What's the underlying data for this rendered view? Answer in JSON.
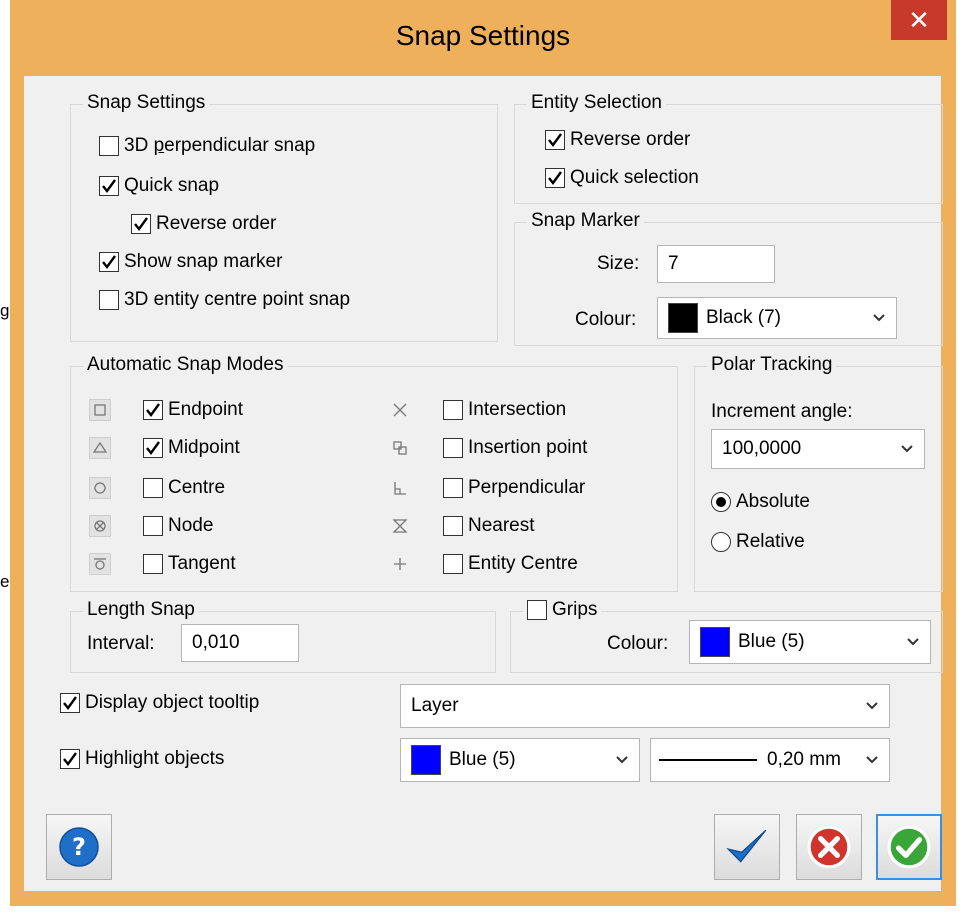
{
  "window": {
    "title": "Snap Settings",
    "close_glyph": "✕"
  },
  "background_fragments": {
    "frag1": "g",
    "frag2": "e"
  },
  "snap_settings": {
    "title": "Snap Settings",
    "perp_snap": {
      "pre": "3D ",
      "underlined": "p",
      "post": "erpendicular snap",
      "checked": false
    },
    "quick_snap": {
      "label": "Quick snap",
      "checked": true
    },
    "reverse_order": {
      "label": "Reverse order",
      "checked": true
    },
    "show_marker": {
      "label": "Show snap marker",
      "checked": true
    },
    "centre_point": {
      "label": "3D entity centre point snap",
      "checked": false
    }
  },
  "entity_selection": {
    "title": "Entity Selection",
    "reverse_order": {
      "label": "Reverse order",
      "checked": true
    },
    "quick_selection": {
      "label": "Quick selection",
      "checked": true
    }
  },
  "snap_marker": {
    "title": "Snap Marker",
    "size_label": "Size:",
    "size_value": "7",
    "colour_label": "Colour:",
    "colour_value": "Black (7)",
    "colour_swatch": "#000000"
  },
  "auto_snap": {
    "title": "Automatic Snap Modes",
    "left": [
      {
        "icon": "square-snap-icon",
        "label": "Endpoint",
        "checked": true
      },
      {
        "icon": "triangle-snap-icon",
        "label": "Midpoint",
        "checked": true
      },
      {
        "icon": "circle-snap-icon",
        "label": "Centre",
        "checked": false
      },
      {
        "icon": "node-snap-icon",
        "label": "Node",
        "checked": false
      },
      {
        "icon": "tangent-snap-icon",
        "label": "Tangent",
        "checked": false
      }
    ],
    "right": [
      {
        "icon": "intersection-snap-icon",
        "label": "Intersection",
        "checked": false
      },
      {
        "icon": "insertion-snap-icon",
        "label": "Insertion point",
        "checked": false
      },
      {
        "icon": "perpendicular-snap-icon",
        "label": "Perpendicular",
        "checked": false
      },
      {
        "icon": "nearest-snap-icon",
        "label": "Nearest",
        "checked": false
      },
      {
        "icon": "entity-centre-snap-icon",
        "label": "Entity Centre",
        "checked": false
      }
    ]
  },
  "polar_tracking": {
    "title": "Polar Tracking",
    "increment_label": "Increment angle:",
    "increment_value": "100,0000",
    "absolute": {
      "label": "Absolute",
      "selected": true
    },
    "relative": {
      "label": "Relative",
      "selected": false
    }
  },
  "length_snap": {
    "title": "Length Snap",
    "interval_label": "Interval:",
    "interval_value": "0,010"
  },
  "grips": {
    "label": "Grips",
    "checked": false,
    "colour_label": "Colour:",
    "colour_value": "Blue (5)",
    "colour_swatch": "#0000ff"
  },
  "tooltip": {
    "label": "Display object tooltip",
    "checked": true,
    "value": "Layer"
  },
  "highlight": {
    "label": "Highlight objects",
    "checked": true,
    "colour_value": "Blue (5)",
    "colour_swatch": "#0000ff",
    "lineweight": "0,20 mm"
  },
  "colors": {
    "title_bar": "#efb05c",
    "close": "#c7392b",
    "check_blue": "#1e6fc4",
    "cancel_red": "#d0342c",
    "ok_green": "#3aa63a",
    "help_blue": "#1f6fc9"
  }
}
